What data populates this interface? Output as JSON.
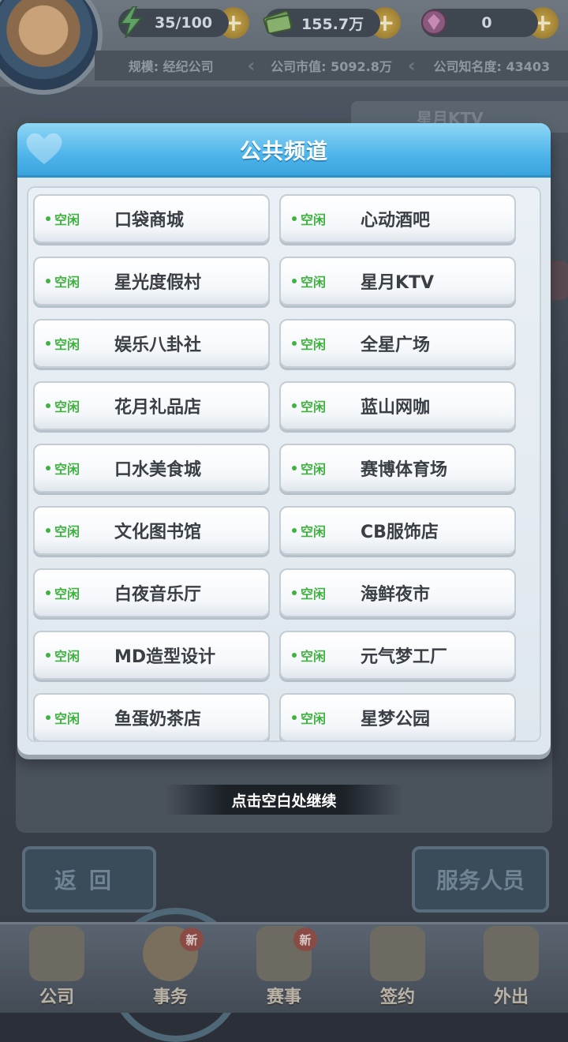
{
  "hud": {
    "energy": {
      "icon": "lightning-icon",
      "value": "35/100"
    },
    "money": {
      "icon": "cash-stack-icon",
      "value": "155.7万"
    },
    "gems": {
      "icon": "gem-icon",
      "value": "0"
    },
    "plus_label": "+",
    "info": {
      "scale": "规模: 经纪公司",
      "market_value": "公司市值: 5092.8万",
      "fame": "公司知名度: 43403"
    }
  },
  "background": {
    "tab_label": "星月KTV",
    "back_button": "返回",
    "service_button": "服务人员",
    "nav": [
      {
        "label": "公司",
        "icon": "company-building-icon",
        "badge": ""
      },
      {
        "label": "事务",
        "icon": "manager-avatar-icon",
        "badge": "新"
      },
      {
        "label": "赛事",
        "icon": "trophy-icon",
        "badge": "新"
      },
      {
        "label": "签约",
        "icon": "contract-hand-icon",
        "badge": ""
      },
      {
        "label": "外出",
        "icon": "door-exit-icon",
        "badge": ""
      }
    ]
  },
  "modal": {
    "title": "公共频道",
    "channels": [
      {
        "status": "空闲",
        "name": "口袋商城"
      },
      {
        "status": "空闲",
        "name": "心动酒吧"
      },
      {
        "status": "空闲",
        "name": "星光度假村"
      },
      {
        "status": "空闲",
        "name": "星月KTV"
      },
      {
        "status": "空闲",
        "name": "娱乐八卦社"
      },
      {
        "status": "空闲",
        "name": "全星广场"
      },
      {
        "status": "空闲",
        "name": "花月礼品店"
      },
      {
        "status": "空闲",
        "name": "蓝山网咖"
      },
      {
        "status": "空闲",
        "name": "口水美食城"
      },
      {
        "status": "空闲",
        "name": "赛博体育场"
      },
      {
        "status": "空闲",
        "name": "文化图书馆"
      },
      {
        "status": "空闲",
        "name": "CB服饰店"
      },
      {
        "status": "空闲",
        "name": "白夜音乐厅"
      },
      {
        "status": "空闲",
        "name": "海鲜夜市"
      },
      {
        "status": "空闲",
        "name": "MD造型设计"
      },
      {
        "status": "空闲",
        "name": "元气梦工厂"
      },
      {
        "status": "空闲",
        "name": "鱼蛋奶茶店"
      },
      {
        "status": "空闲",
        "name": "星梦公园"
      }
    ]
  },
  "hint": "点击空白处继续",
  "colors": {
    "accent": "#4fb5ea",
    "status_idle": "#3fb23f"
  }
}
